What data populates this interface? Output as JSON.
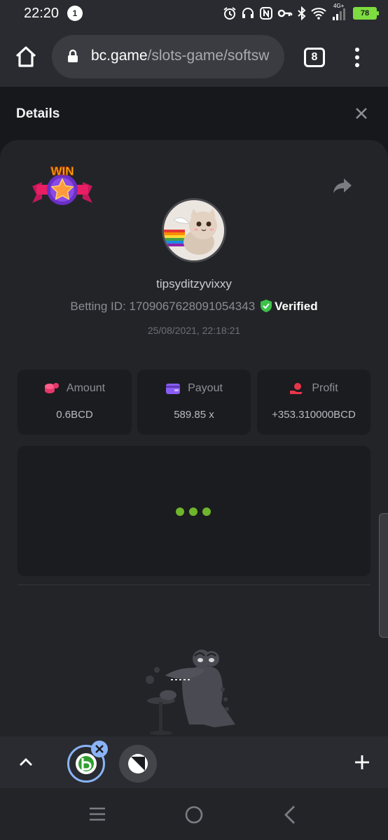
{
  "status_bar": {
    "time": "22:20",
    "notification_count": "1",
    "network": "4G+",
    "battery_level": "78"
  },
  "browser": {
    "url_host": "bc.game",
    "url_path": "/slots-game/softsw",
    "tab_count": "8"
  },
  "details": {
    "title": "Details",
    "badge_text": "WIN",
    "username": "tipsyditzyvixxy",
    "betting_id_label": "Betting ID:",
    "betting_id": "1709067628091054343",
    "verified_label": "Verified",
    "timestamp": "25/08/2021, 22:18:21"
  },
  "stats": [
    {
      "label": "Amount",
      "value": "0.6BCD",
      "icon": "coins-icon",
      "color": "#e6376a"
    },
    {
      "label": "Payout",
      "value": "589.85 x",
      "icon": "wallet-icon",
      "color": "#8a5cf6"
    },
    {
      "label": "Profit",
      "value": "+353.310000BCD",
      "icon": "profit-icon",
      "color": "#e8354a"
    }
  ],
  "colors": {
    "accent_green": "#6fb52c",
    "verified_green": "#3cc24a",
    "tab_ring": "#8ab4f8"
  }
}
